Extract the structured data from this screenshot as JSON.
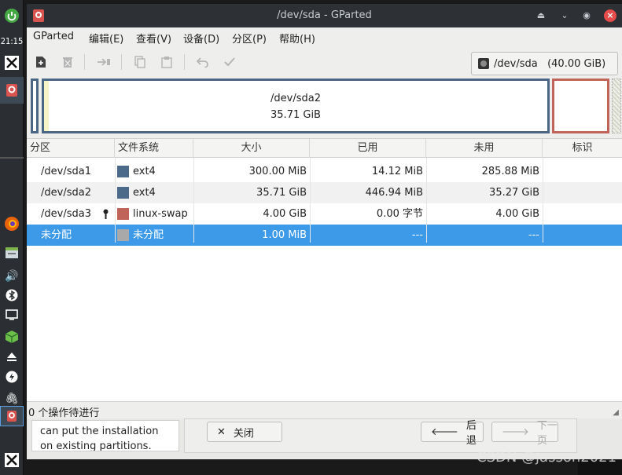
{
  "taskbar": {
    "clock": "21:15",
    "icons": [
      "power-icon",
      "x-app-icon",
      "gparted-icon",
      "firefox-icon",
      "files-icon",
      "volume-icon",
      "bluetooth-icon",
      "display-icon",
      "package-icon",
      "eject-icon",
      "power-manager-icon",
      "clip-icon",
      "gparted-active-icon",
      "x-app-bottom-icon"
    ]
  },
  "window": {
    "title": "/dev/sda - GParted",
    "controls": [
      "minimize",
      "restore",
      "maximize",
      "close"
    ]
  },
  "menu": {
    "items": [
      "GParted",
      "编辑(E)",
      "查看(V)",
      "设备(D)",
      "分区(P)",
      "帮助(H)"
    ]
  },
  "toolbar": {
    "icons": [
      "new-icon",
      "delete-icon",
      "resize-move-icon",
      "copy-icon",
      "paste-icon",
      "undo-icon",
      "apply-icon"
    ],
    "device_selector": "/dev/sda   (40.00 GiB)"
  },
  "partition_map": {
    "selected_label": "/dev/sda2",
    "selected_size": "35.71 GiB"
  },
  "table": {
    "headers": [
      "分区",
      "文件系统",
      "大小",
      "已用",
      "未用",
      "标识"
    ],
    "rows": [
      {
        "partition": "/dev/sda1",
        "fs": "ext4",
        "fs_color": "#4b6a8a",
        "size": "300.00 MiB",
        "used": "14.12 MiB",
        "unused": "285.88 MiB",
        "flags": ""
      },
      {
        "partition": "/dev/sda2",
        "fs": "ext4",
        "fs_color": "#4b6a8a",
        "size": "35.71 GiB",
        "used": "446.94 MiB",
        "unused": "35.27 GiB",
        "flags": ""
      },
      {
        "partition": "/dev/sda3",
        "fs": "linux-swap",
        "fs_color": "#c0645a",
        "size": "4.00 GiB",
        "used": "0.00 字节",
        "unused": "4.00 GiB",
        "flags": ""
      },
      {
        "partition": "未分配",
        "fs": "未分配",
        "fs_color": "#a9a9a9",
        "size": "1.00 MiB",
        "used": "---",
        "unused": "---",
        "flags": ""
      }
    ]
  },
  "status": {
    "text": "0 个操作待进行"
  },
  "installer": {
    "info_line1": "can put the installation",
    "info_line2": "on existing partitions.",
    "close_label": "关闭",
    "back_label": "后退",
    "next_label": "下一页"
  },
  "watermark": "CSDN @jasson2021"
}
